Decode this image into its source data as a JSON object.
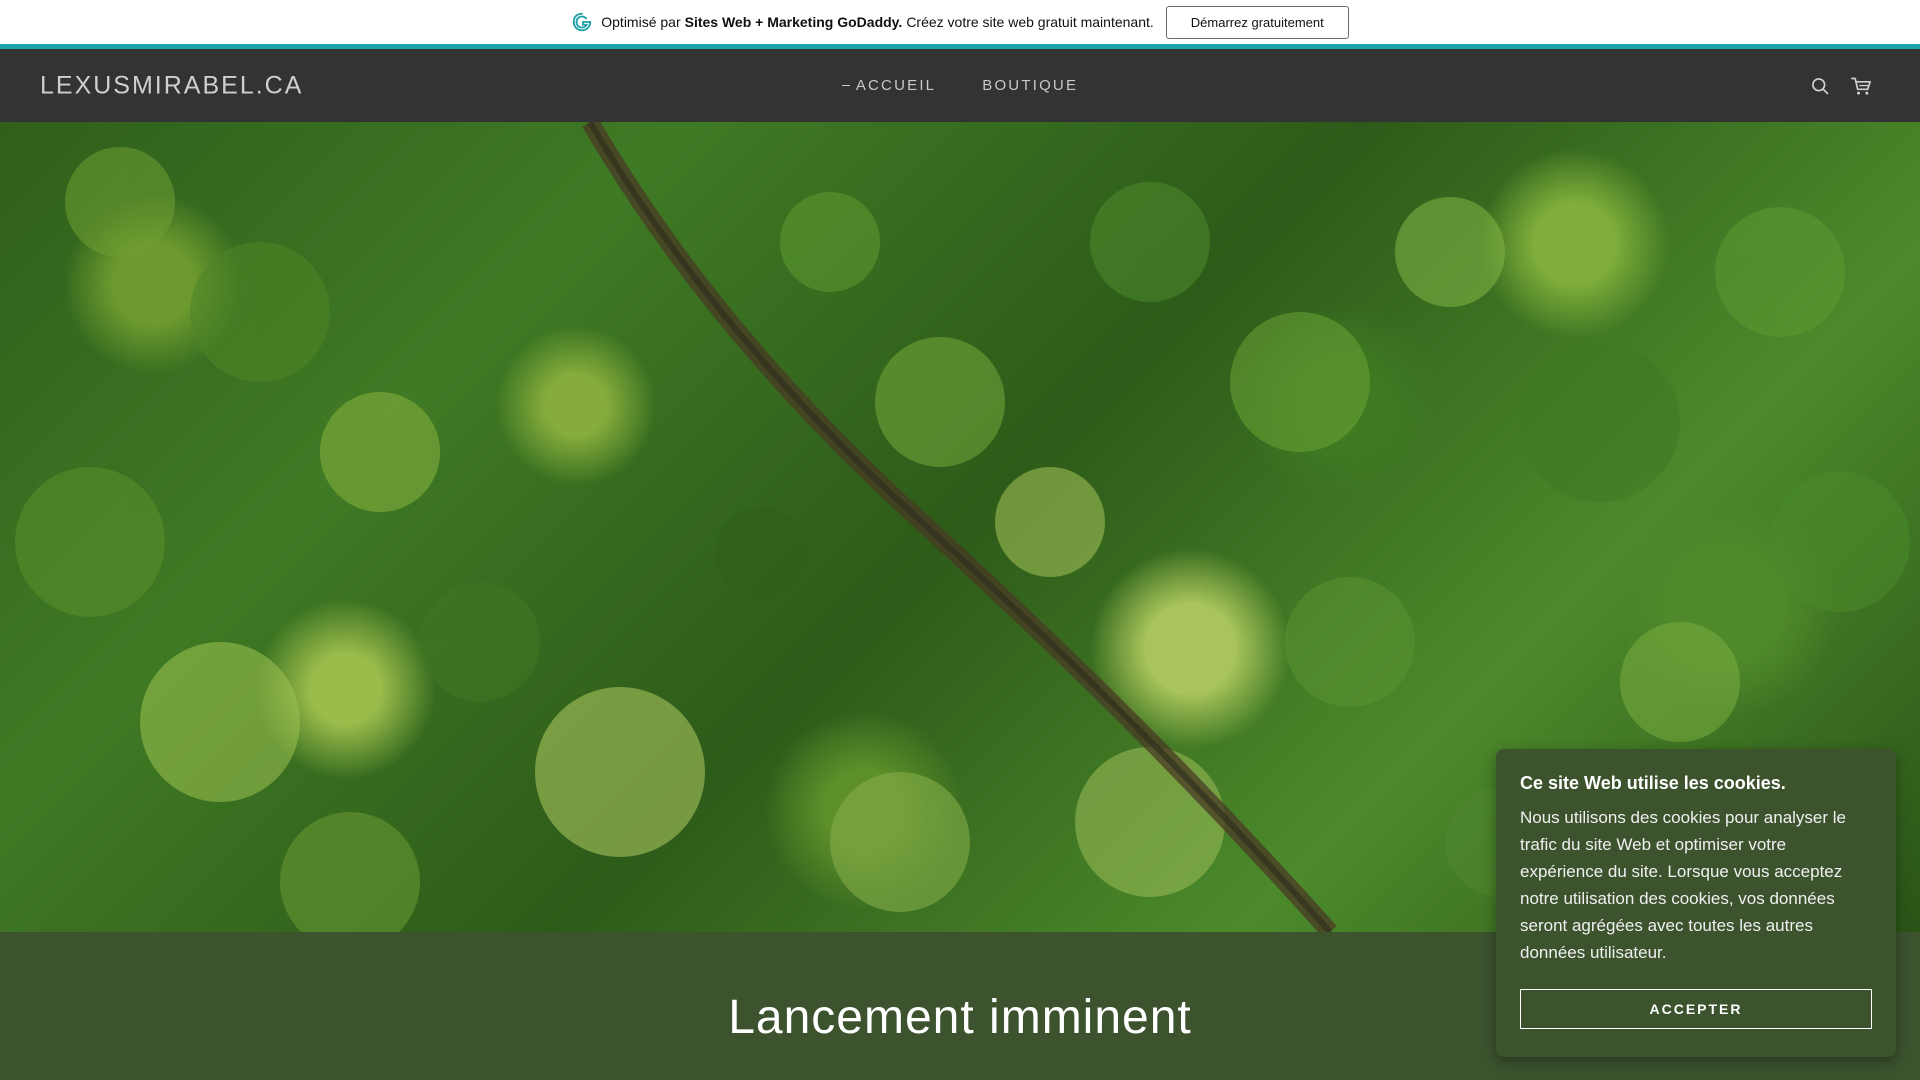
{
  "promo": {
    "prefix": "Optimisé par",
    "brand": "Sites Web + Marketing GoDaddy.",
    "suffix": "Créez votre site web gratuit maintenant.",
    "cta_label": "Démarrez gratuitement",
    "icon": "godaddy-icon"
  },
  "header": {
    "logo": "LEXUSMIRABEL.CA",
    "nav": [
      {
        "label": "ACCUEIL",
        "active": true
      },
      {
        "label": "BOUTIQUE",
        "active": false
      }
    ],
    "icons": [
      "search-icon",
      "cart-icon"
    ]
  },
  "hero": {
    "image": "aerial-forest-image"
  },
  "band": {
    "heading": "Lancement imminent"
  },
  "cookie": {
    "title": "Ce site Web utilise les cookies.",
    "body": "Nous utilisons des cookies pour analyser le trafic du site Web et optimiser votre expérience du site. Lorsque vous acceptez notre utilisation des cookies, vos données seront agrégées avec toutes les autres données utilisateur.",
    "accept_label": "ACCEPTER"
  },
  "colors": {
    "header_bg": "#333333",
    "accent_teal": "#1fa1a8",
    "band_green": "#3c532e"
  }
}
